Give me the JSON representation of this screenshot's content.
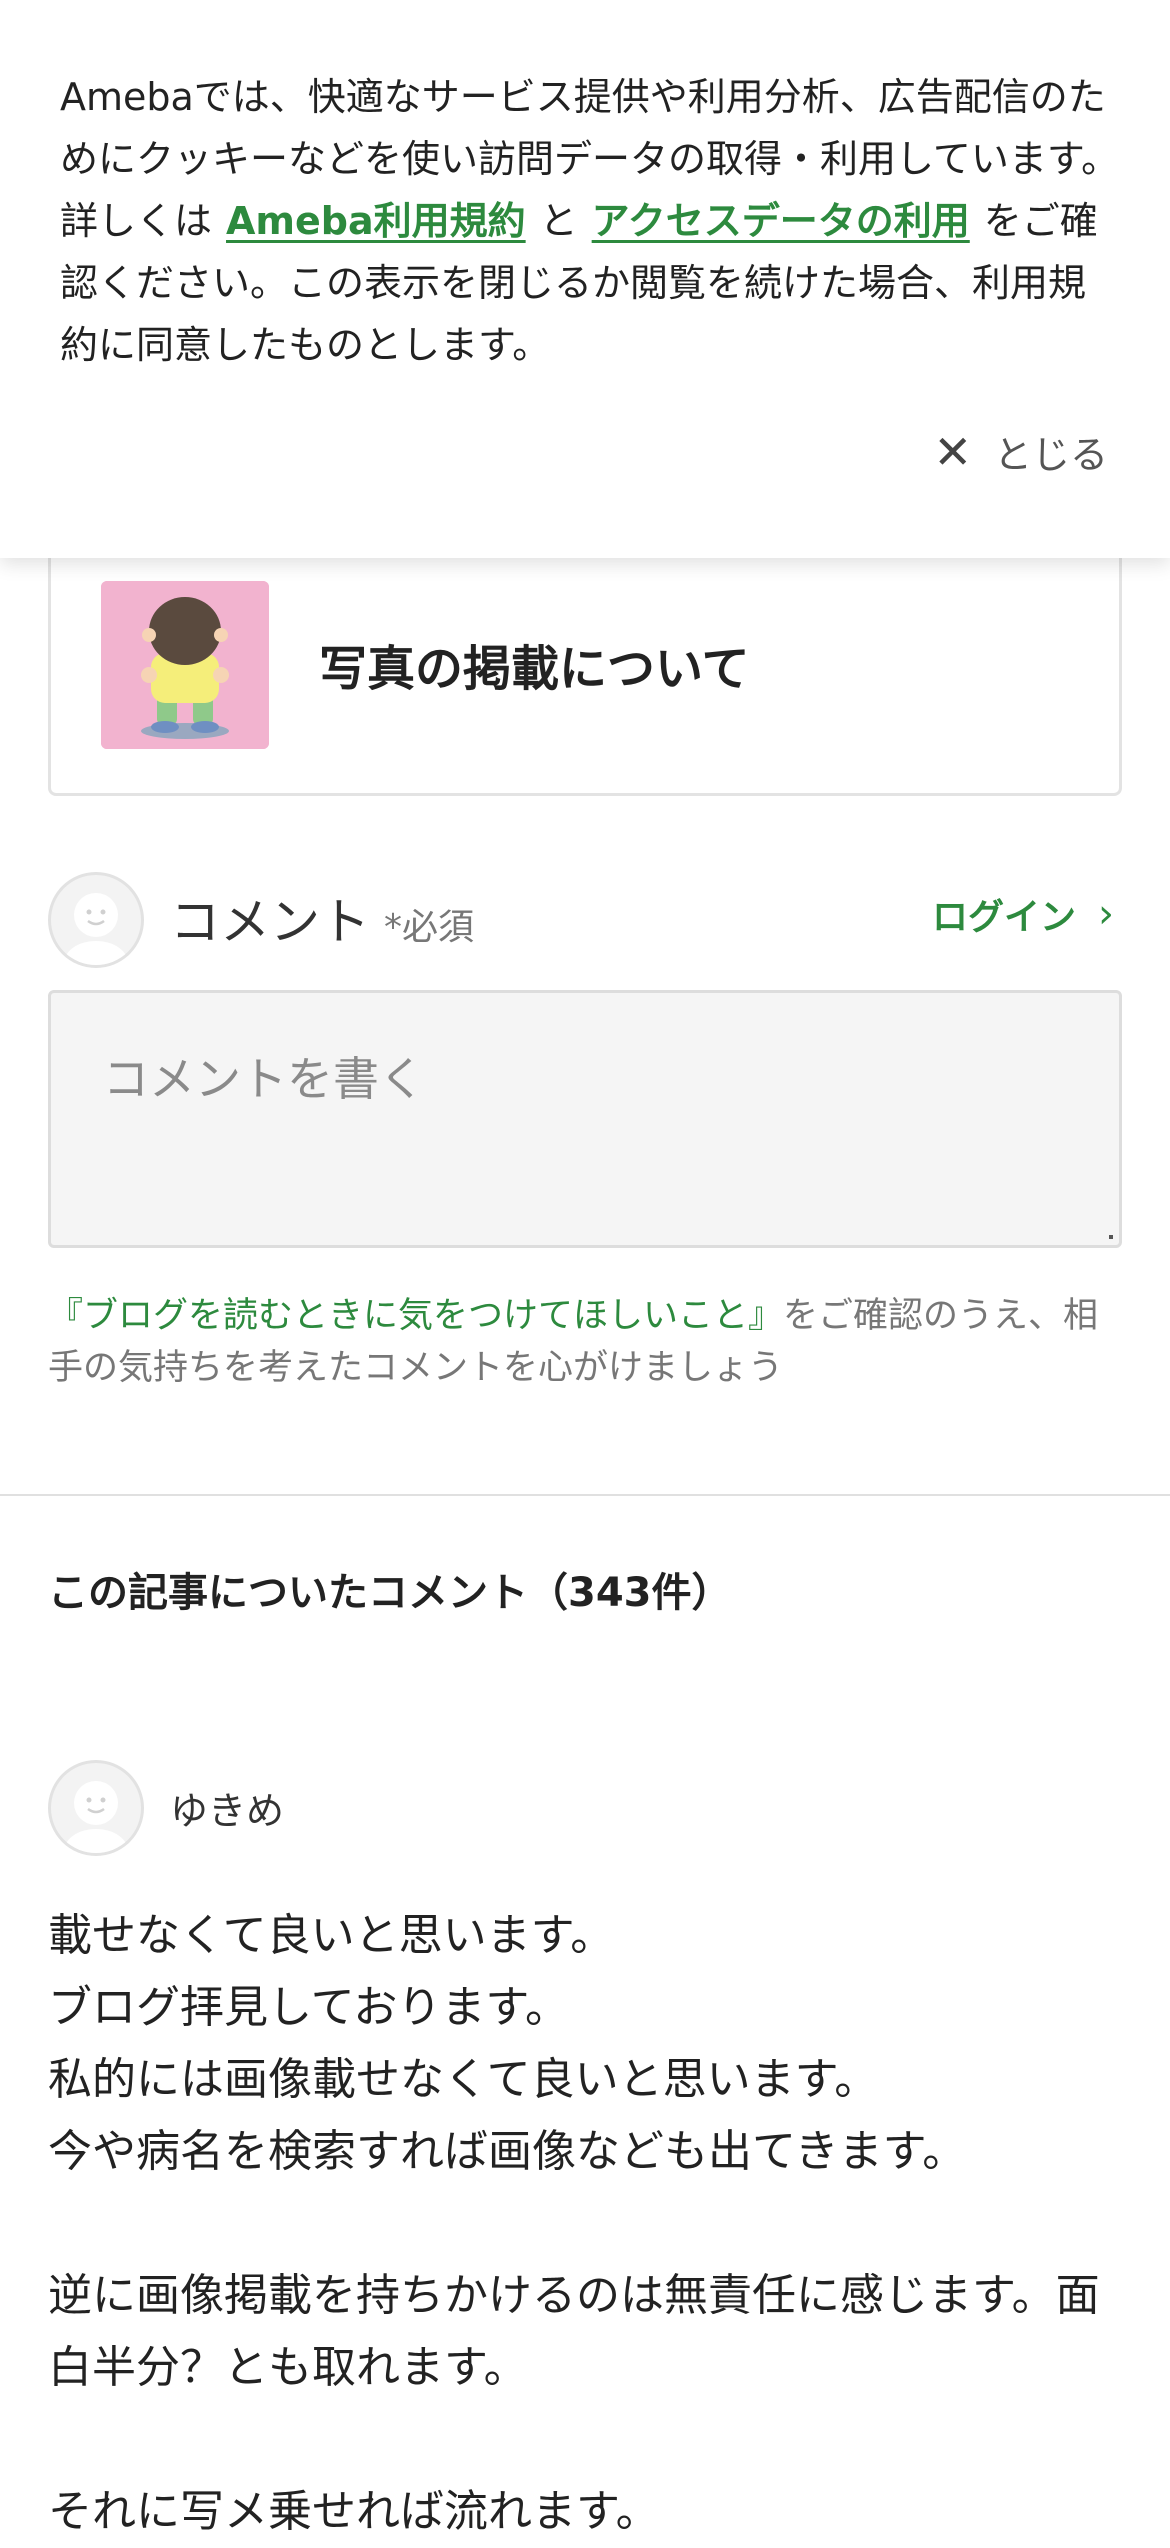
{
  "cookie_banner": {
    "text_before": "Amebaでは、快適なサービス提供や利用分析、広告配信のためにクッキーなどを使い訪問データの取得・利用しています。詳しくは",
    "link_terms": "Ameba利用規約",
    "conjunction": "と",
    "link_access": "アクセスデータの利用",
    "text_after": "をご確認ください。この表示を閉じるか閲覧を続けた場合、利用規約に同意したものとします。",
    "close_label": "とじる"
  },
  "related_article": {
    "title": "写真の掲載について"
  },
  "comment_form": {
    "label": "コメント",
    "required": "*必須",
    "login_label": "ログイン",
    "placeholder": "コメントを書く",
    "guideline_link": "『ブログを読むときに気をつけてほしいこと』",
    "guideline_text": "をご確認のうえ、相手の気持ちを考えたコメントを心がけましょう"
  },
  "comments_section": {
    "heading": "この記事についたコメント（343件）",
    "comments": [
      {
        "author": "ゆきめ",
        "lines": [
          "載せなくて良いと思います。",
          "ブログ拝見しております。",
          "私的には画像載せなくて良いと思います。",
          "今や病名を検索すれば画像なども出てきます。",
          "",
          "逆に画像掲載を持ちかけるのは無責任に感じます。面白半分？とも取れます。",
          "",
          "それに写メ乗せれば流れます。"
        ]
      }
    ]
  },
  "colors": {
    "accent_green": "#2d8a3e",
    "thumb_pink": "#f2b3cf"
  }
}
